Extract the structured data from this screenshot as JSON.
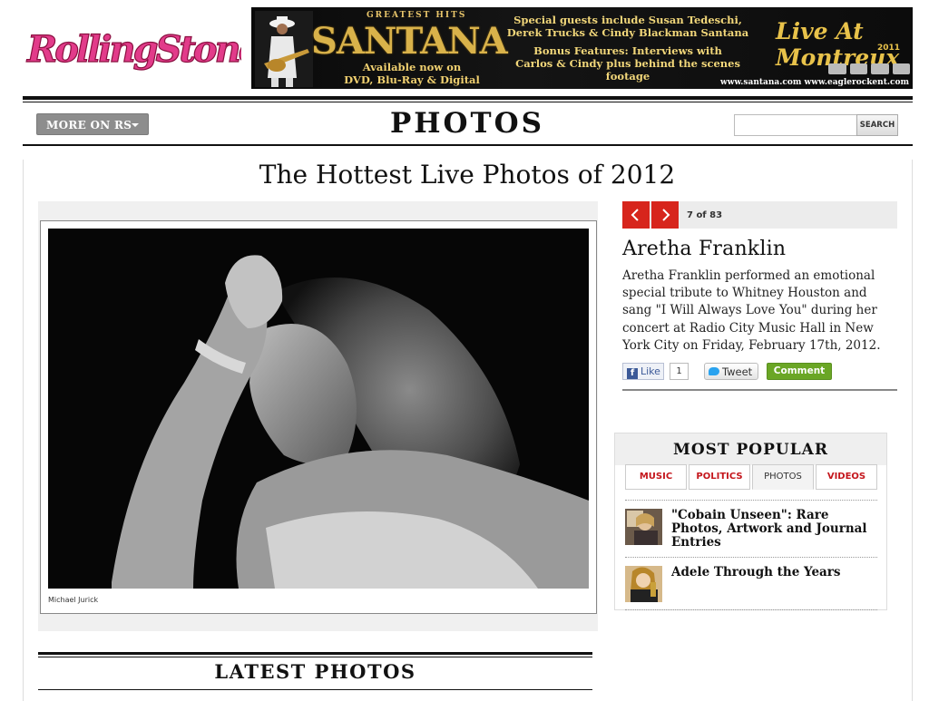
{
  "header": {
    "logo_text": "RollingStone",
    "ad": {
      "greatest_hits": "GREATEST HITS",
      "artist": "SANTANA",
      "available_line1": "Available now on",
      "available_line2": "DVD, Blu-Ray & Digital",
      "guests_line1": "Special guests include Susan Tedeschi,",
      "guests_line2": "Derek Trucks & Cindy Blackman Santana",
      "bonus_line1": "Bonus Features: Interviews with",
      "bonus_line2": "Carlos & Cindy plus behind the scenes footage",
      "event": "Live At Montreux",
      "event_year": "2011",
      "urls": "www.santana.com www.eaglerockent.com"
    }
  },
  "nav": {
    "more_label": "MORE ON RS",
    "section_title": "PHOTOS",
    "search_placeholder": "",
    "search_button": "SEARCH"
  },
  "gallery": {
    "title": "The Hottest Live Photos of 2012",
    "photo_credit": "Michael Jurick",
    "position": "7 of 83",
    "artist": "Aretha Franklin",
    "caption": "Aretha Franklin performed an emotional special tribute to Whitney Houston and sang \"I Will Always Love You\" during her concert at Radio City Music Hall in New York City on Friday, February 17th, 2012."
  },
  "share": {
    "like_label": "Like",
    "like_count": "1",
    "tweet_label": "Tweet",
    "comment_label": "Comment"
  },
  "latest": {
    "title": "LATEST PHOTOS"
  },
  "most_popular": {
    "title": "MOST POPULAR",
    "tabs": [
      {
        "label": "MUSIC",
        "active": false
      },
      {
        "label": "POLITICS",
        "active": false
      },
      {
        "label": "PHOTOS",
        "active": true
      },
      {
        "label": "VIDEOS",
        "active": false
      }
    ],
    "items": [
      {
        "title": "\"Cobain Unseen\": Rare Photos, Artwork and Journal Entries"
      },
      {
        "title": "Adele Through the Years"
      }
    ]
  },
  "colors": {
    "accent_red": "#d7251c",
    "comment_green": "#6aa625",
    "facebook_blue": "#3b5998"
  }
}
